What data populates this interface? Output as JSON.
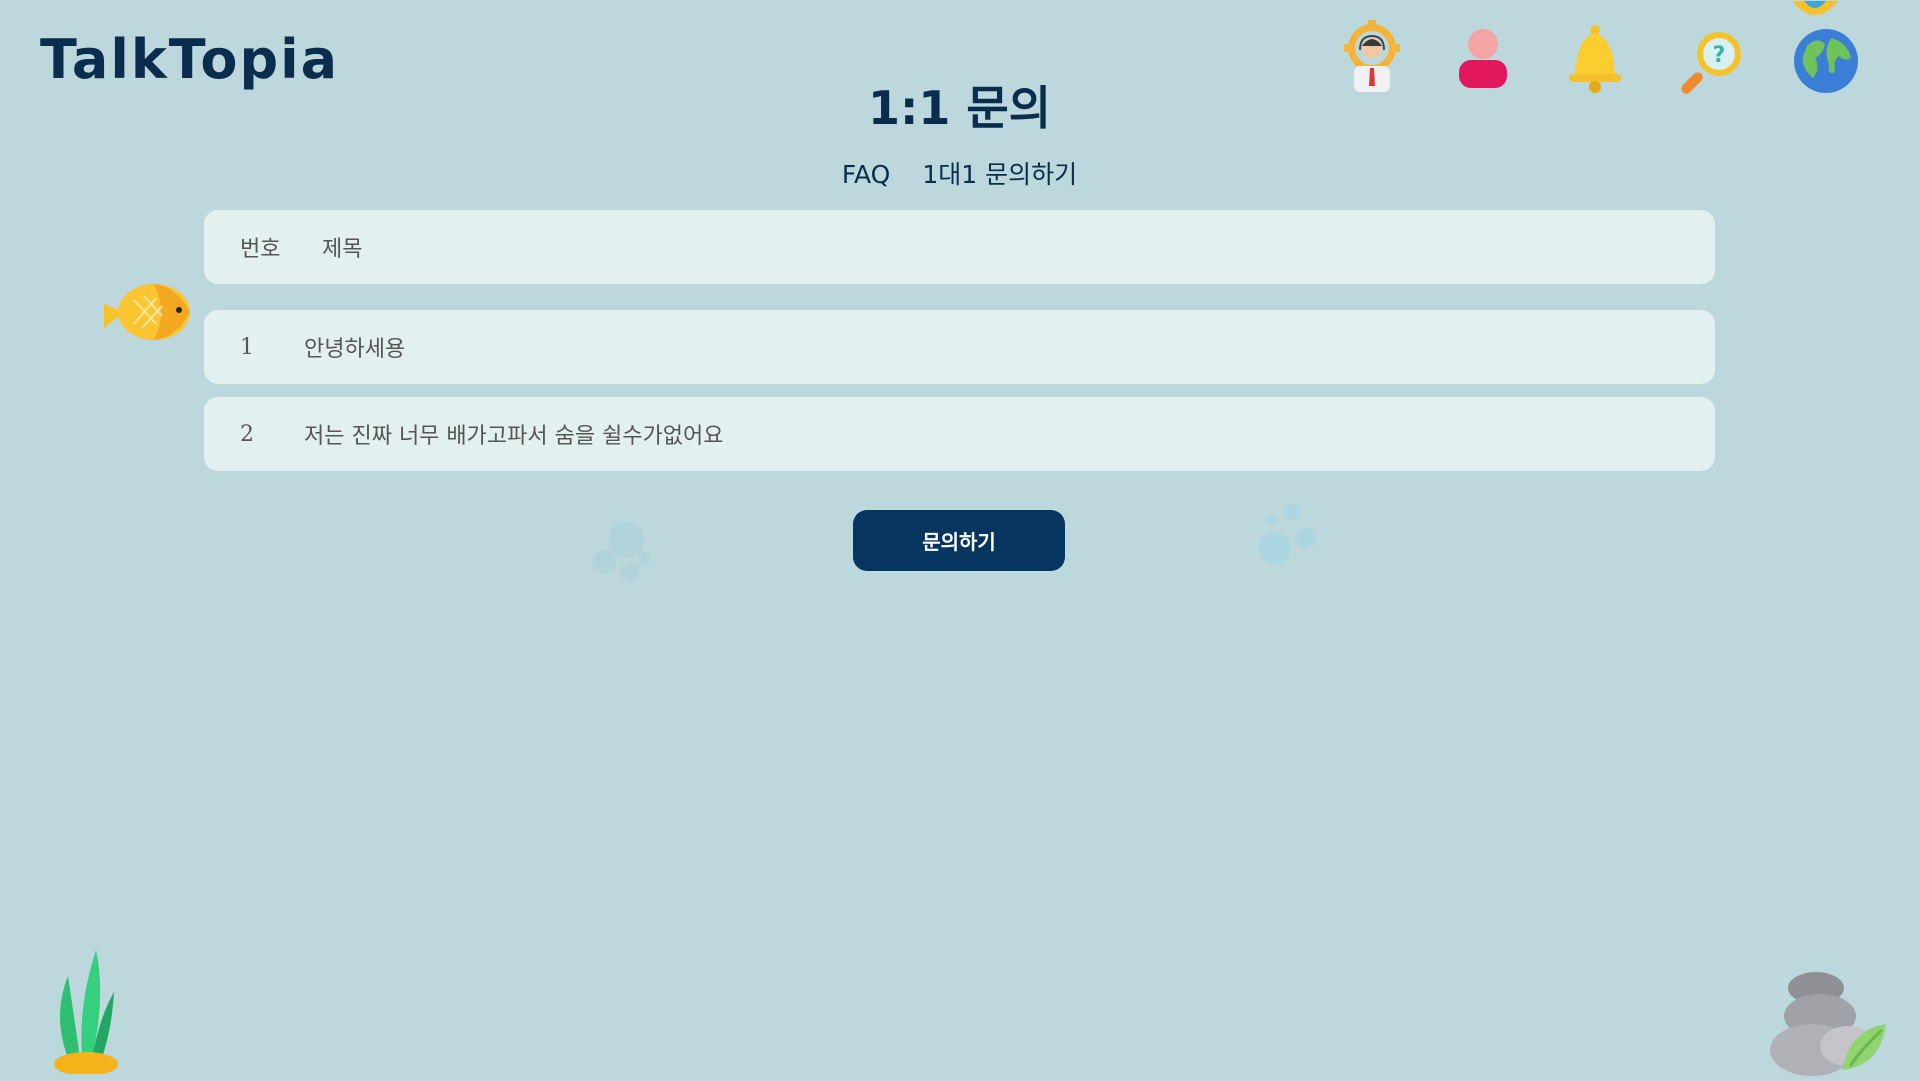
{
  "app": {
    "logo": "TalkTopia"
  },
  "page": {
    "title": "1:1 문의"
  },
  "subnav": {
    "faq": "FAQ",
    "inquiry": "1대1 문의하기"
  },
  "table": {
    "headers": {
      "number": "번호",
      "title": "제목"
    },
    "rows": [
      {
        "number": "1",
        "title": "안녕하세용"
      },
      {
        "number": "2",
        "title": "저는 진짜 너무 배가고파서 숨을 쉴수가없어요"
      }
    ]
  },
  "actions": {
    "inquire": "문의하기"
  },
  "icons": {
    "top": [
      "counselor-icon",
      "profile-icon",
      "bell-icon",
      "help-search-icon",
      "globe-icon"
    ],
    "decorative": [
      "fish-icon",
      "bubbles-icon",
      "seaweed-icon",
      "rocks-icon"
    ]
  },
  "colors": {
    "background": "#bdd8dc",
    "primary": "#06365f",
    "row": "#e3f0f0",
    "text": "#0a2d4d"
  }
}
